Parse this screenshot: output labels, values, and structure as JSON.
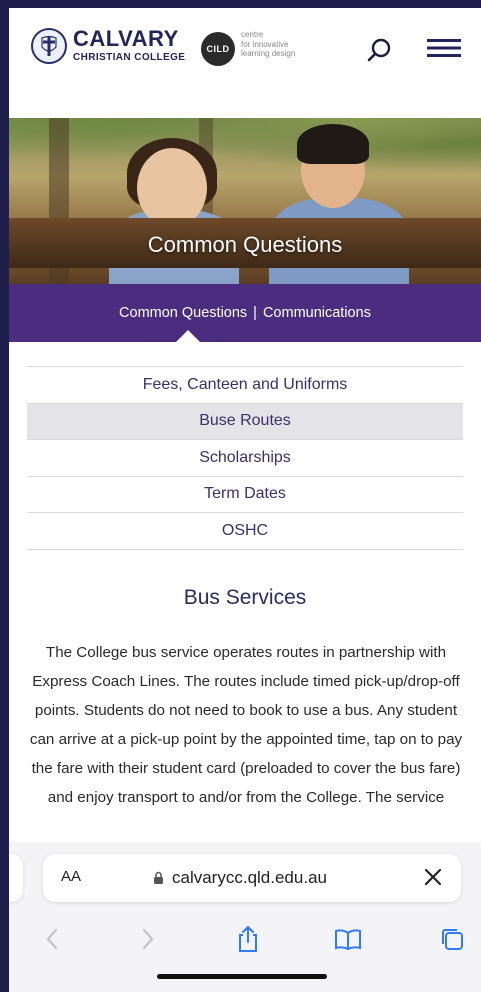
{
  "header": {
    "brand_name": "CALVARY",
    "brand_sub": "CHRISTIAN COLLEGE",
    "cild_logo": "CILD",
    "cild_line1": "centre",
    "cild_line2": "for innovative",
    "cild_line3": "learning design",
    "icons": {
      "search": "search-icon",
      "menu": "hamburger-icon"
    }
  },
  "hero": {
    "title": "Common Questions"
  },
  "subnav": {
    "item1": "Common Questions",
    "separator": "|",
    "item2": "Communications"
  },
  "links": [
    {
      "label": "Fees, Canteen and Uniforms",
      "active": false
    },
    {
      "label": "Buse Routes",
      "active": true
    },
    {
      "label": "Scholarships",
      "active": false
    },
    {
      "label": "Term Dates",
      "active": false
    },
    {
      "label": "OSHC",
      "active": false
    }
  ],
  "section": {
    "title": "Bus Services",
    "body": "The College bus service operates routes in partnership with Express Coach Lines. The routes include timed pick-up/drop-off points. Students do not need to book to use a bus. Any student can arrive at a pick-up point by the appointed time, tap on to pay the fare with their student card (preloaded to cover the bus fare) and enjoy transport to and/or from the College. The service"
  },
  "browser": {
    "aa_label": "AA",
    "url": "calvarycc.qld.edu.au",
    "icons": {
      "lock": "lock-icon",
      "close": "close-icon",
      "back": "back-arrow-icon",
      "forward": "forward-arrow-icon",
      "share": "share-icon",
      "bookmarks": "bookmarks-icon",
      "tabs": "tabs-icon"
    }
  },
  "colors": {
    "purple_bar": "#4b2d7f",
    "brand_navy": "#24245c",
    "link_text": "#3b2f6d",
    "active_row": "#e4e4e6",
    "ios_blue": "#2f7bf5"
  }
}
